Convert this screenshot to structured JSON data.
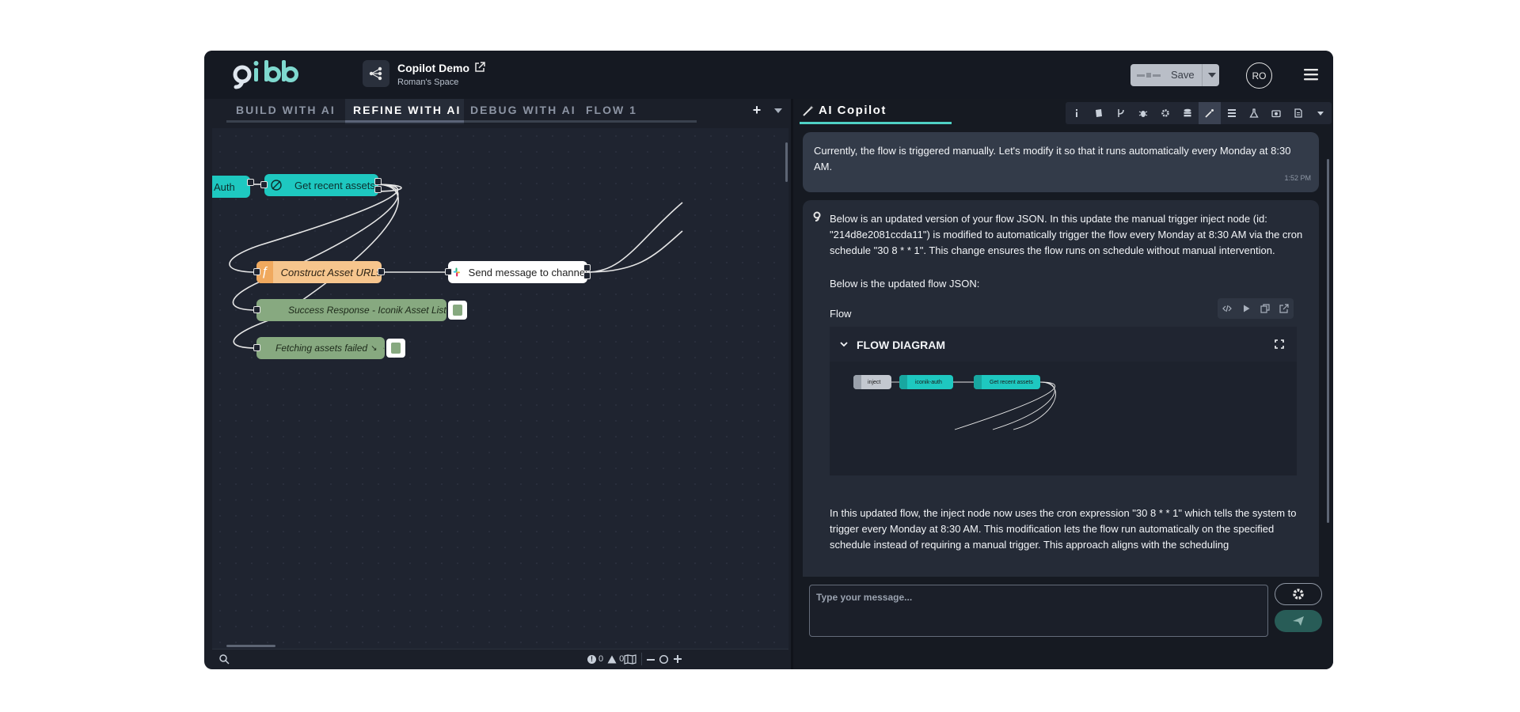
{
  "header": {
    "logo_text": "qibb",
    "flow_title": "Copilot Demo",
    "flow_space": "Roman's Space",
    "save_label": "Save",
    "avatar_initials": "RO"
  },
  "workspace": {
    "tabs": [
      {
        "label": "BUILD WITH AI",
        "active": false
      },
      {
        "label": "REFINE WITH AI",
        "active": true
      },
      {
        "label": "DEBUG WITH AI",
        "active": false
      },
      {
        "label": "FLOW 1",
        "active": false
      }
    ],
    "add_tab_label": "+",
    "nodes": {
      "auth": "Auth",
      "get_assets": "Get recent assets",
      "construct_urls": "Construct Asset URLs",
      "send_message": "Send message to channel",
      "success": "Success Response - Iconik Asset List",
      "failed": "Fetching assets failed"
    },
    "status": {
      "errors": "0",
      "warnings": "0"
    }
  },
  "panel": {
    "tab_label": "AI Copilot",
    "messages": {
      "user_text": "Currently, the flow is triggered manually. Let's modify it so that it runs automatically every Monday at 8:30 AM.",
      "user_time": "1:52 PM",
      "ai_text1": "Below is an updated version of your flow JSON. In this update the manual trigger inject node (id: \"214d8e2081ccda11\") is modified to automatically trigger the flow every Monday at 8:30 AM via the cron schedule \"30 8 * * 1\". This change ensures the flow runs on schedule without manual intervention.",
      "ai_text2": "Below is the updated flow JSON:",
      "flow_label": "Flow",
      "diagram_title": "FLOW DIAGRAM",
      "mini_nodes": {
        "inject": "inject",
        "auth": "iconik-auth",
        "get": "Get recent assets"
      },
      "ai_text3": "In this updated flow, the inject node now uses the cron expression \"30 8 * * 1\" which tells the system to trigger every Monday at 8:30 AM. This modification lets the flow run automatically on the specified schedule instead of requiring a manual trigger. This approach aligns with the scheduling"
    },
    "composer_placeholder": "Type your message..."
  },
  "colors": {
    "accent_teal": "#1ec8c0",
    "function_orange": "#f6c58d",
    "debug_green": "#87a980",
    "panel_bg": "#161a22"
  }
}
